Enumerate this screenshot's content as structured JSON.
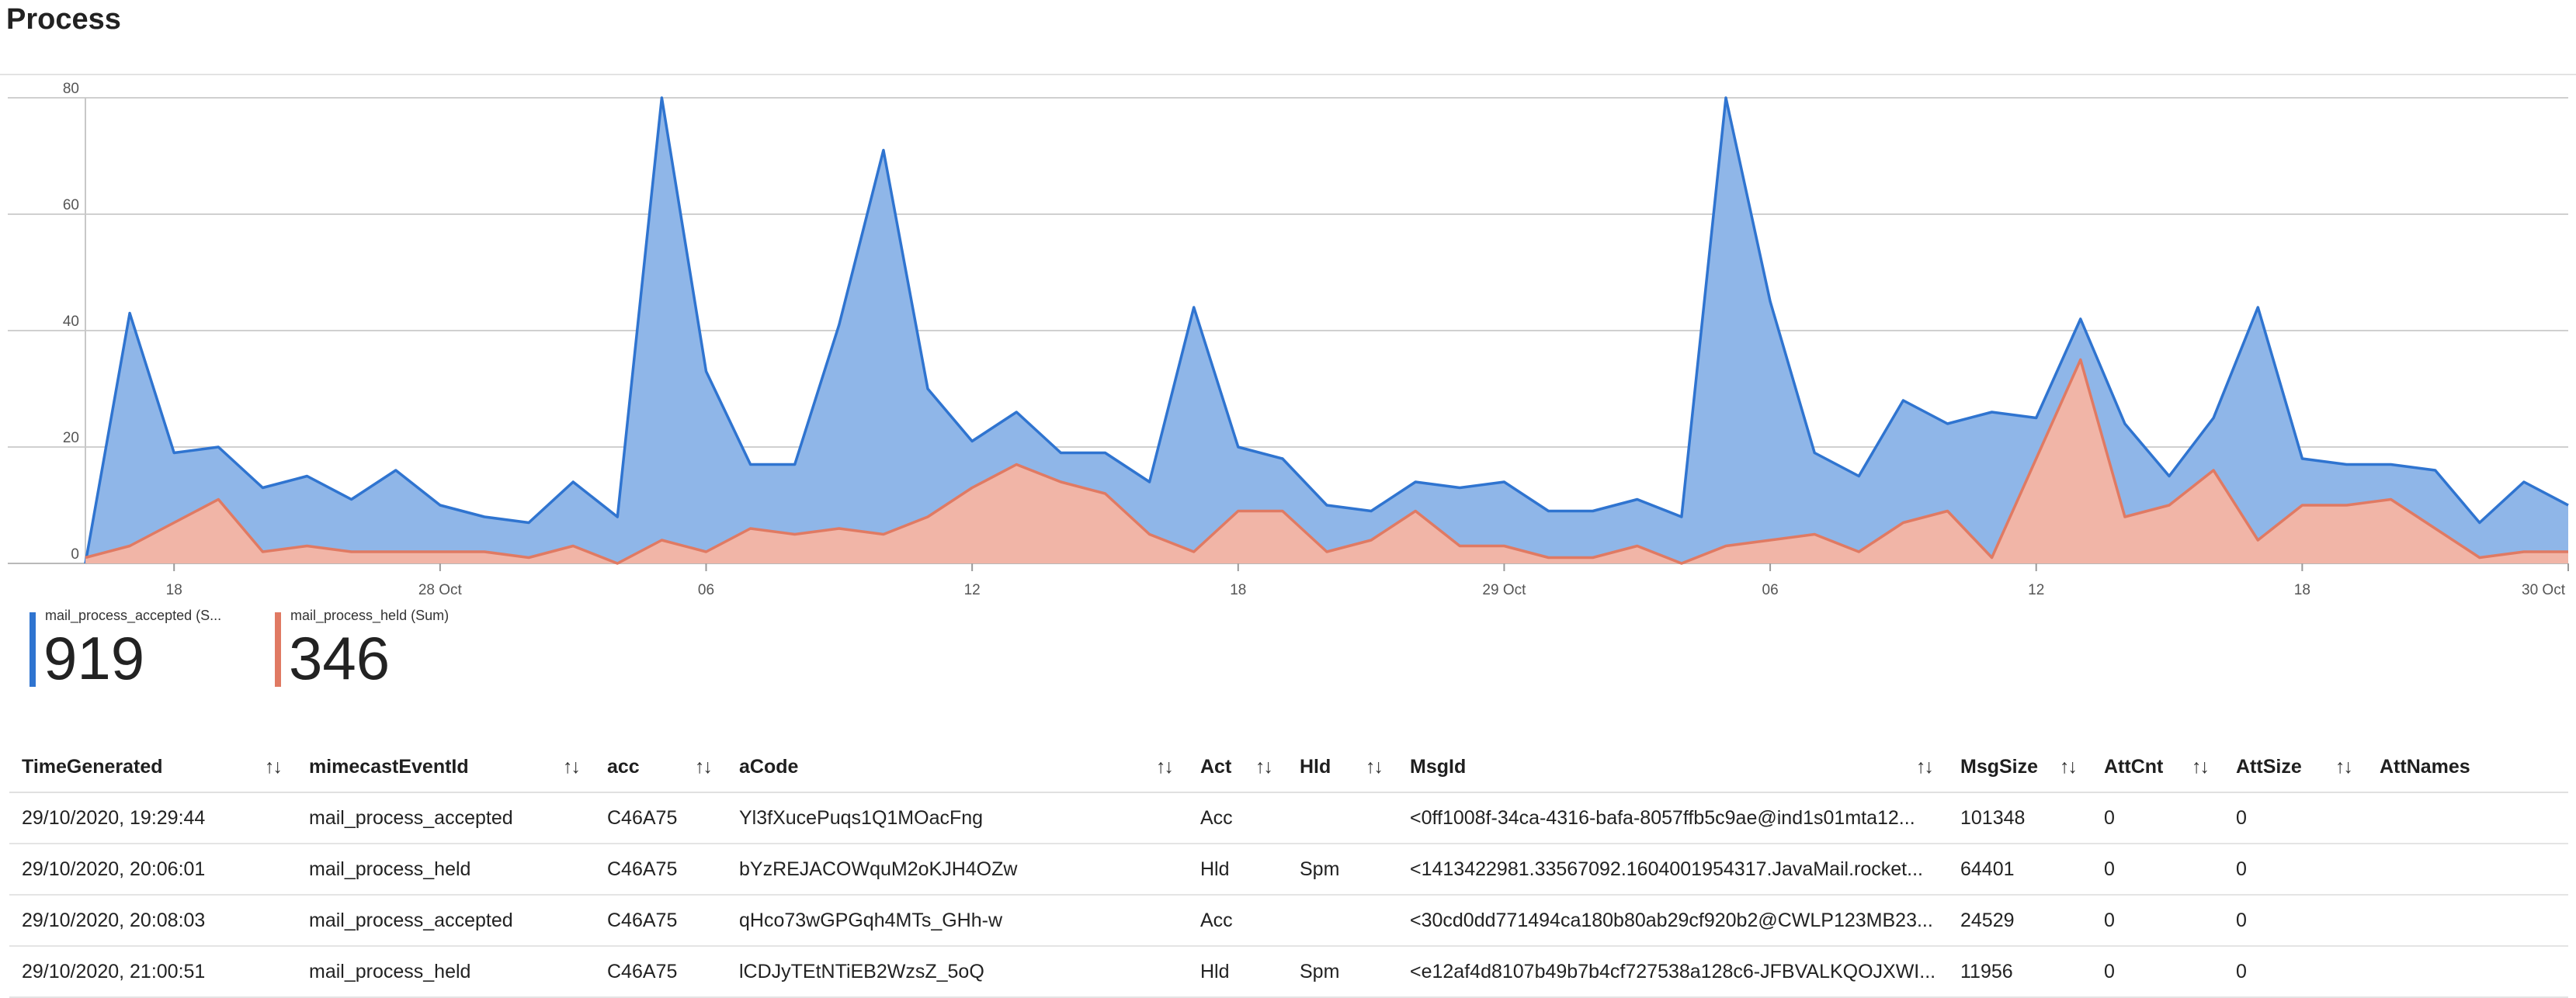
{
  "page": {
    "title": "Process"
  },
  "chart_data": {
    "type": "area",
    "title": "",
    "xlabel": "",
    "ylabel": "",
    "ylim": [
      0,
      80
    ],
    "yticks": [
      0,
      20,
      40,
      60,
      80
    ],
    "x_tick_labels": [
      {
        "label": "18",
        "index": 2
      },
      {
        "label": "28 Oct",
        "index": 8
      },
      {
        "label": "06",
        "index": 14
      },
      {
        "label": "12",
        "index": 20
      },
      {
        "label": "18",
        "index": 26
      },
      {
        "label": "29 Oct",
        "index": 32
      },
      {
        "label": "06",
        "index": 38
      },
      {
        "label": "12",
        "index": 44
      },
      {
        "label": "18",
        "index": 50
      },
      {
        "label": "30 Oct",
        "index": 56
      }
    ],
    "grid": true,
    "legend_position": "bottom-left",
    "series": [
      {
        "name": "mail_process_accepted (S...",
        "total": "919",
        "color": "#2f74d0",
        "fill": "#8fb6e8",
        "values": [
          0,
          43,
          19,
          20,
          13,
          15,
          11,
          16,
          10,
          8,
          7,
          14,
          8,
          80,
          33,
          17,
          17,
          41,
          71,
          30,
          21,
          26,
          19,
          19,
          14,
          44,
          20,
          18,
          10,
          9,
          14,
          13,
          14,
          9,
          9,
          11,
          8,
          80,
          45,
          19,
          15,
          28,
          24,
          26,
          25,
          42,
          24,
          15,
          25,
          44,
          18,
          17,
          17,
          16,
          7,
          14,
          10
        ]
      },
      {
        "name": "mail_process_held (Sum)",
        "total": "346",
        "color": "#e07a63",
        "fill": "#f1b5a7",
        "values": [
          1,
          3,
          7,
          11,
          2,
          3,
          2,
          2,
          2,
          2,
          1,
          3,
          0,
          4,
          2,
          6,
          5,
          6,
          5,
          8,
          13,
          17,
          14,
          12,
          5,
          2,
          9,
          9,
          2,
          4,
          9,
          3,
          3,
          1,
          1,
          3,
          0,
          3,
          4,
          5,
          2,
          7,
          9,
          1,
          18,
          35,
          8,
          10,
          16,
          4,
          10,
          10,
          11,
          6,
          1,
          2,
          2
        ]
      }
    ]
  },
  "table": {
    "columns": [
      {
        "label": "TimeGenerated",
        "sort": "↑↓"
      },
      {
        "label": "mimecastEventId",
        "sort": "↑↓"
      },
      {
        "label": "acc",
        "sort": "↑↓"
      },
      {
        "label": "aCode",
        "sort": "↑↓"
      },
      {
        "label": "Act",
        "sort": "↑↓"
      },
      {
        "label": "Hld",
        "sort": "↑↓"
      },
      {
        "label": "MsgId",
        "sort": "↑↓"
      },
      {
        "label": "MsgSize",
        "sort": "↑↓"
      },
      {
        "label": "AttCnt",
        "sort": "↑↓"
      },
      {
        "label": "AttSize",
        "sort": "↑↓"
      },
      {
        "label": "AttNames",
        "sort": ""
      }
    ],
    "rows": [
      [
        "29/10/2020, 19:29:44",
        "mail_process_accepted",
        "C46A75",
        "Yl3fXucePuqs1Q1MOacFng",
        "Acc",
        "",
        "<0ff1008f-34ca-4316-bafa-8057ffb5c9ae@ind1s01mta12...",
        "101348",
        "0",
        "0",
        ""
      ],
      [
        "29/10/2020, 20:06:01",
        "mail_process_held",
        "C46A75",
        "bYzREJACOWquM2oKJH4OZw",
        "Hld",
        "Spm",
        "<1413422981.33567092.1604001954317.JavaMail.rocket...",
        "64401",
        "0",
        "0",
        ""
      ],
      [
        "29/10/2020, 20:08:03",
        "mail_process_accepted",
        "C46A75",
        "qHco73wGPGqh4MTs_GHh-w",
        "Acc",
        "",
        "<30cd0dd771494ca180b80ab29cf920b2@CWLP123MB23...",
        "24529",
        "0",
        "0",
        ""
      ],
      [
        "29/10/2020, 21:00:51",
        "mail_process_held",
        "C46A75",
        "lCDJyTEtNTiEB2WzsZ_5oQ",
        "Hld",
        "Spm",
        "<e12af4d8107b49b7b4cf727538a128c6-JFBVALKQOJXWI...",
        "11956",
        "0",
        "0",
        ""
      ]
    ]
  }
}
